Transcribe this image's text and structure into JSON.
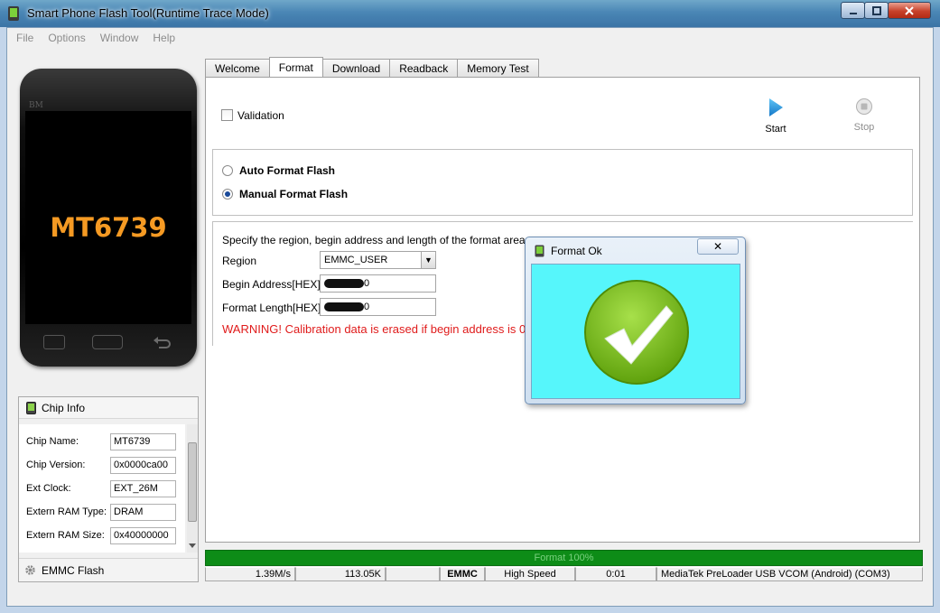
{
  "window": {
    "title": "Smart Phone Flash Tool(Runtime Trace Mode)"
  },
  "menu": [
    "File",
    "Options",
    "Window",
    "Help"
  ],
  "phone": {
    "brand": "BM",
    "chip": "MT6739"
  },
  "chip_info": {
    "header": "Chip Info",
    "rows": [
      {
        "label": "Chip Name:",
        "value": "MT6739"
      },
      {
        "label": "Chip Version:",
        "value": "0x0000ca00"
      },
      {
        "label": "Ext Clock:",
        "value": "EXT_26M"
      },
      {
        "label": "Extern RAM Type:",
        "value": "DRAM"
      },
      {
        "label": "Extern RAM Size:",
        "value": "0x40000000"
      }
    ],
    "footer": "EMMC Flash"
  },
  "tabs": [
    "Welcome",
    "Format",
    "Download",
    "Readback",
    "Memory Test"
  ],
  "active_tab": "Format",
  "format": {
    "validation_label": "Validation",
    "start_label": "Start",
    "stop_label": "Stop",
    "auto_label": "Auto Format Flash",
    "manual_label": "Manual Format Flash",
    "instructions": "Specify the region, begin address and length of the format area.",
    "region_label": "Region",
    "region_value": "EMMC_USER",
    "begin_label": "Begin Address[HEX]:",
    "begin_value_suffix": "0",
    "length_label": "Format Length[HEX]:",
    "length_value_suffix": "0",
    "warning": "WARNING! Calibration data is erased if begin address is 0."
  },
  "dialog": {
    "title": "Format Ok",
    "close": "✕"
  },
  "progress": {
    "text": "Format 100%",
    "fraction": 1.0
  },
  "status": {
    "speed": "1.39M/s",
    "size": "113.05K",
    "storage": "EMMC",
    "mode": "High Speed",
    "time": "0:01",
    "port": "MediaTek PreLoader USB VCOM (Android) (COM3)"
  },
  "colors": {
    "progress": "#0d8c17",
    "warning": "#e01b1b",
    "dialog_body": "#56f6fb",
    "check_green": "#7cc414"
  }
}
